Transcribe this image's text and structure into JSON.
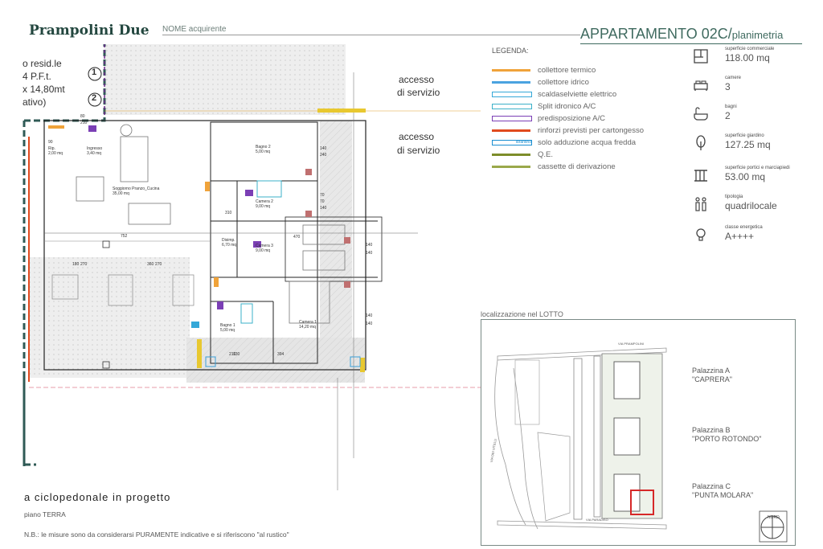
{
  "header": {
    "brand": "Prampolini Due",
    "buyer_label": "NOME acquirente",
    "apartment_title": "APPARTAMENTO 02C/",
    "apartment_subtitle": "planimetria"
  },
  "legend": {
    "title": "LEGENDA:",
    "items": [
      {
        "label": "collettore termico",
        "color": "#f0a33a"
      },
      {
        "label": "collettore idrico",
        "color": "#4aa3e0"
      },
      {
        "label": "scaldaselviette elettrico",
        "color": "#35a8d8"
      },
      {
        "label": "Split idronico A/C",
        "color": "#3bb0c9"
      },
      {
        "label": "predisposizione A/C",
        "color": "#7b3fb5"
      },
      {
        "label": "rinforzi previsti per cartongesso",
        "color": "#e04a1e"
      },
      {
        "label": "solo adduzione acqua fredda",
        "color": "#1b8fd1"
      },
      {
        "label": "Q.E.",
        "color": "#7d8d2a"
      },
      {
        "label": "cassette di derivazione",
        "color": "#9aa84a"
      }
    ],
    "idrantino_tag": "idrantino"
  },
  "specs": [
    {
      "label": "superficie commerciale",
      "value": "118.00 mq",
      "icon": "floorplan-icon"
    },
    {
      "label": "camere",
      "value": "3",
      "icon": "bed-icon"
    },
    {
      "label": "bagni",
      "value": "2",
      "icon": "bathtub-icon"
    },
    {
      "label": "superficie giardino",
      "value": "127.25 mq",
      "icon": "tree-icon"
    },
    {
      "label": "superficie portici e marciapiedi",
      "value": "53.00 mq",
      "icon": "porch-icon"
    },
    {
      "label": "tipologia",
      "value": "quadrilocale",
      "icon": "people-icon"
    },
    {
      "label": "classe energetica",
      "value": "A++++",
      "icon": "bulb-icon"
    }
  ],
  "plan": {
    "accesso_1": "accesso",
    "servizio_1": "di servizio",
    "accesso_2": "accesso",
    "servizio_2": "di servizio",
    "cut_lines": [
      "o resid.le",
      "4 P.F.t.",
      "x 14,80mt",
      "ativo)"
    ],
    "markers": [
      "1",
      "2"
    ],
    "rooms": [
      {
        "name": "Soggiorno Pranzo_Cucina",
        "area": "35,00 mq"
      },
      {
        "name": "Ingresso",
        "area": "3,40 mq"
      },
      {
        "name": "Bagno 2",
        "area": "5,00 mq"
      },
      {
        "name": "Camera 2",
        "area": "9,00 mq"
      },
      {
        "name": "Disimp.",
        "area": "6,70 mq"
      },
      {
        "name": "Camera 3",
        "area": "9,00 mq"
      },
      {
        "name": "Camera 1",
        "area": "14,20 mq"
      },
      {
        "name": "Bagno 1",
        "area": "5,00 mq"
      },
      {
        "name": "Rip.",
        "area": "2,00 mq"
      }
    ],
    "dimensions": [
      "140",
      "240",
      "140",
      "140",
      "140",
      "140",
      "180",
      "270",
      "360",
      "270",
      "752",
      "70",
      "70",
      "140",
      "394",
      "470",
      "310",
      "210",
      "130",
      "90",
      "80",
      "210"
    ]
  },
  "footer": {
    "ciclopedonale": "a ciclopedonale in progetto",
    "floor": "piano TERRA",
    "note": "N.B.: le misure sono da considerarsi PURAMENTE indicative e si riferiscono \"al rustico\""
  },
  "location": {
    "title": "localizzazione nel LOTTO",
    "palazzine": [
      {
        "name": "Palazzina A",
        "nick": "\"CAPRERA\""
      },
      {
        "name": "Palazzina B",
        "nick": "\"PORTO ROTONDO\""
      },
      {
        "name": "Palazzina C",
        "nick": "\"PUNTA MOLARA\""
      }
    ],
    "street_top": "VIA PRAMPOLINI",
    "street_side": "VIA DEI VITELLI",
    "street_bottom": "VIA PARADISO",
    "north": "NORD"
  }
}
